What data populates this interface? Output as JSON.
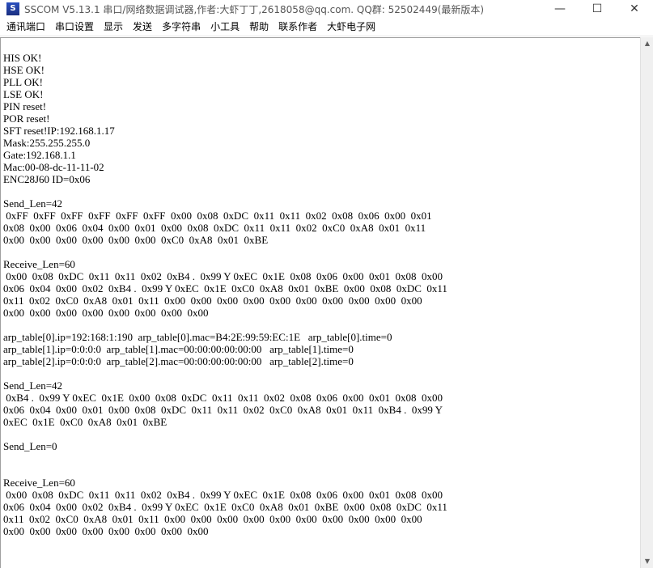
{
  "window": {
    "icon_label": "S",
    "title": "SSCOM V5.13.1 串口/网络数据调试器,作者:大虾丁丁,2618058@qq.com. QQ群: 52502449(最新版本)",
    "minimize_glyph": "—",
    "maximize_glyph": "☐",
    "close_glyph": "✕"
  },
  "menu": {
    "items": [
      "通讯端口",
      "串口设置",
      "显示",
      "发送",
      "多字符串",
      "小工具",
      "帮助",
      "联系作者",
      "大虾电子网"
    ]
  },
  "scrollbar": {
    "up_glyph": "▲",
    "down_glyph": "▼"
  },
  "log": {
    "lines": [
      "HIS OK!",
      "HSE OK!",
      "PLL OK!",
      "LSE OK!",
      "PIN reset!",
      "POR reset!",
      "SFT reset!IP:192.168.1.17",
      "Mask:255.255.255.0",
      "Gate:192.168.1.1",
      "Mac:00-08-dc-11-11-02",
      "ENC28J60 ID=0x06",
      "",
      "Send_Len=42",
      " 0xFF  0xFF  0xFF  0xFF  0xFF  0xFF  0x00  0x08  0xDC  0x11  0x11  0x02  0x08  0x06  0x00  0x01",
      "0x08  0x00  0x06  0x04  0x00  0x01  0x00  0x08  0xDC  0x11  0x11  0x02  0xC0  0xA8  0x01  0x11",
      "0x00  0x00  0x00  0x00  0x00  0x00  0xC0  0xA8  0x01  0xBE",
      "",
      "Receive_Len=60",
      " 0x00  0x08  0xDC  0x11  0x11  0x02  0xB4 .  0x99 Y 0xEC  0x1E  0x08  0x06  0x00  0x01  0x08  0x00",
      "0x06  0x04  0x00  0x02  0xB4 .  0x99 Y 0xEC  0x1E  0xC0  0xA8  0x01  0xBE  0x00  0x08  0xDC  0x11",
      "0x11  0x02  0xC0  0xA8  0x01  0x11  0x00  0x00  0x00  0x00  0x00  0x00  0x00  0x00  0x00  0x00",
      "0x00  0x00  0x00  0x00  0x00  0x00  0x00  0x00",
      "",
      "arp_table[0].ip=192:168:1:190  arp_table[0].mac=B4:2E:99:59:EC:1E   arp_table[0].time=0",
      "arp_table[1].ip=0:0:0:0  arp_table[1].mac=00:00:00:00:00:00   arp_table[1].time=0",
      "arp_table[2].ip=0:0:0:0  arp_table[2].mac=00:00:00:00:00:00   arp_table[2].time=0",
      "",
      "Send_Len=42",
      " 0xB4 .  0x99 Y 0xEC  0x1E  0x00  0x08  0xDC  0x11  0x11  0x02  0x08  0x06  0x00  0x01  0x08  0x00",
      "0x06  0x04  0x00  0x01  0x00  0x08  0xDC  0x11  0x11  0x02  0xC0  0xA8  0x01  0x11  0xB4 .  0x99 Y",
      "0xEC  0x1E  0xC0  0xA8  0x01  0xBE",
      "",
      "Send_Len=0",
      "",
      "",
      "Receive_Len=60",
      " 0x00  0x08  0xDC  0x11  0x11  0x02  0xB4 .  0x99 Y 0xEC  0x1E  0x08  0x06  0x00  0x01  0x08  0x00",
      "0x06  0x04  0x00  0x02  0xB4 .  0x99 Y 0xEC  0x1E  0xC0  0xA8  0x01  0xBE  0x00  0x08  0xDC  0x11",
      "0x11  0x02  0xC0  0xA8  0x01  0x11  0x00  0x00  0x00  0x00  0x00  0x00  0x00  0x00  0x00  0x00",
      "0x00  0x00  0x00  0x00  0x00  0x00  0x00  0x00"
    ]
  }
}
